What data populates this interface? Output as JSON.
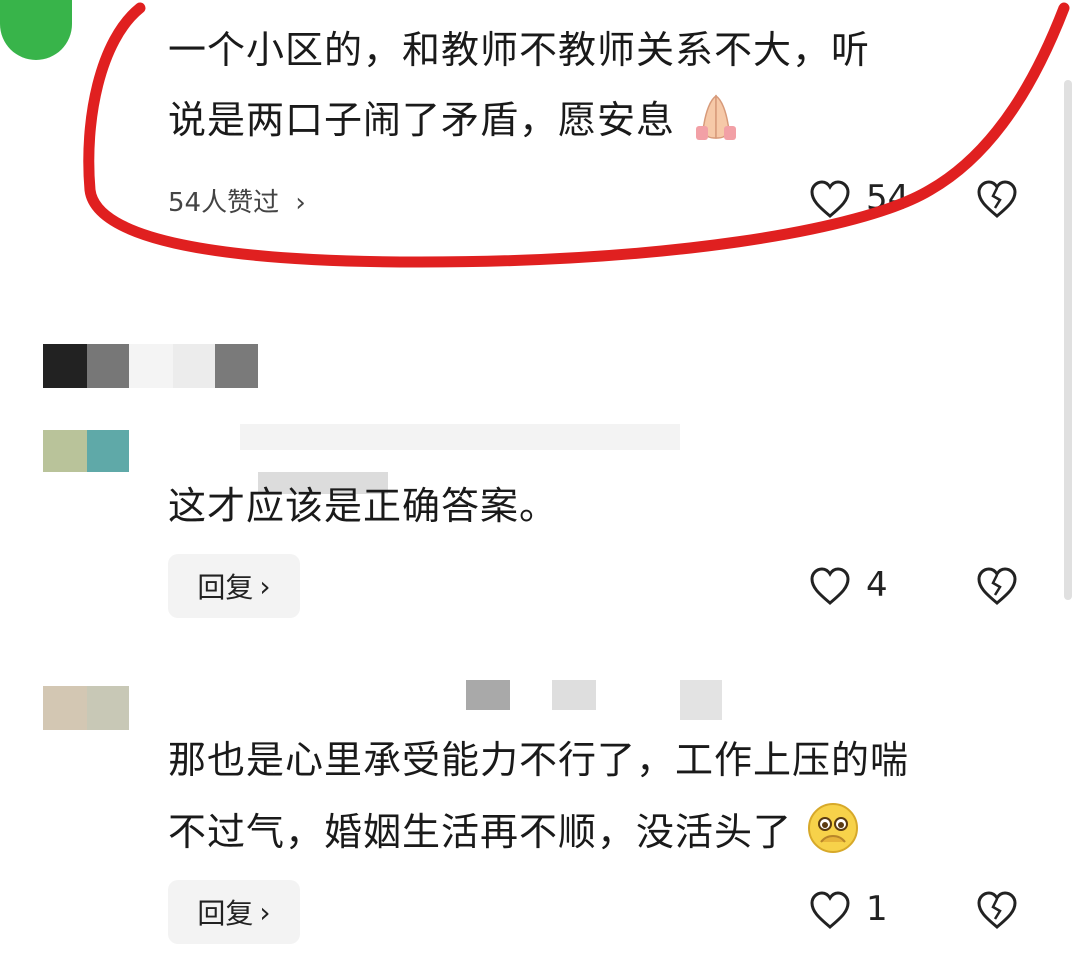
{
  "comments": [
    {
      "text_line1": "一个小区的，和教师不教师关系不大，听",
      "text_line2": "说是两口子闹了矛盾，愿安息",
      "likes_summary": "54人赞过",
      "chevron": "›",
      "like_count": "54",
      "emoji": "folded-hands-icon"
    },
    {
      "text": "这才应该是正确答案。",
      "reply_label": "回复",
      "like_count": "4"
    },
    {
      "text_line1": "那也是心里承受能力不行了，工作上压的喘",
      "text_line2": "不过气，婚姻生活再不顺，没活头了",
      "reply_label": "回复",
      "like_count": "1",
      "emoji": "pleading-face-icon"
    }
  ],
  "annotation": {
    "color": "#e02020"
  },
  "icons": {
    "like": "heart-icon",
    "dislike": "broken-heart-icon"
  }
}
